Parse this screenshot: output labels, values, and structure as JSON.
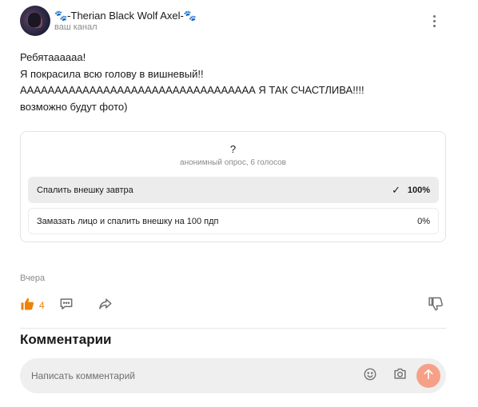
{
  "channel": {
    "name": "🐾-Therian Black Wolf Axel-🐾",
    "subtitle": "ваш канал"
  },
  "post": {
    "lines": [
      "Ребятаааааа!",
      "Я покрасила всю голову в вишневый!!",
      "АААААААААААААААААААААААААААААААААА Я ТАК СЧАСТЛИВА!!!!",
      "возможно будут фото)"
    ]
  },
  "poll": {
    "question": "?",
    "meta": "анонимный опрос, 6 голосов",
    "options": [
      {
        "label": "Спалить внешку завтра",
        "percent_text": "100%",
        "percent": 100,
        "selected": true,
        "check": "✓"
      },
      {
        "label": "Замазать лицо и спалить внешку на 100 пдп",
        "percent_text": "0%",
        "percent": 0,
        "selected": false
      }
    ]
  },
  "date": "Вчера",
  "actions": {
    "likes": "4",
    "icons": [
      "thumbs-up-icon",
      "comment-icon",
      "share-icon",
      "thumbs-down-icon"
    ]
  },
  "comments": {
    "title": "Комментарии",
    "placeholder": "Написать комментарий"
  },
  "colors": {
    "accent": "#ee8208",
    "send_button": "#f5a188",
    "poll_fill": "#ececec"
  }
}
